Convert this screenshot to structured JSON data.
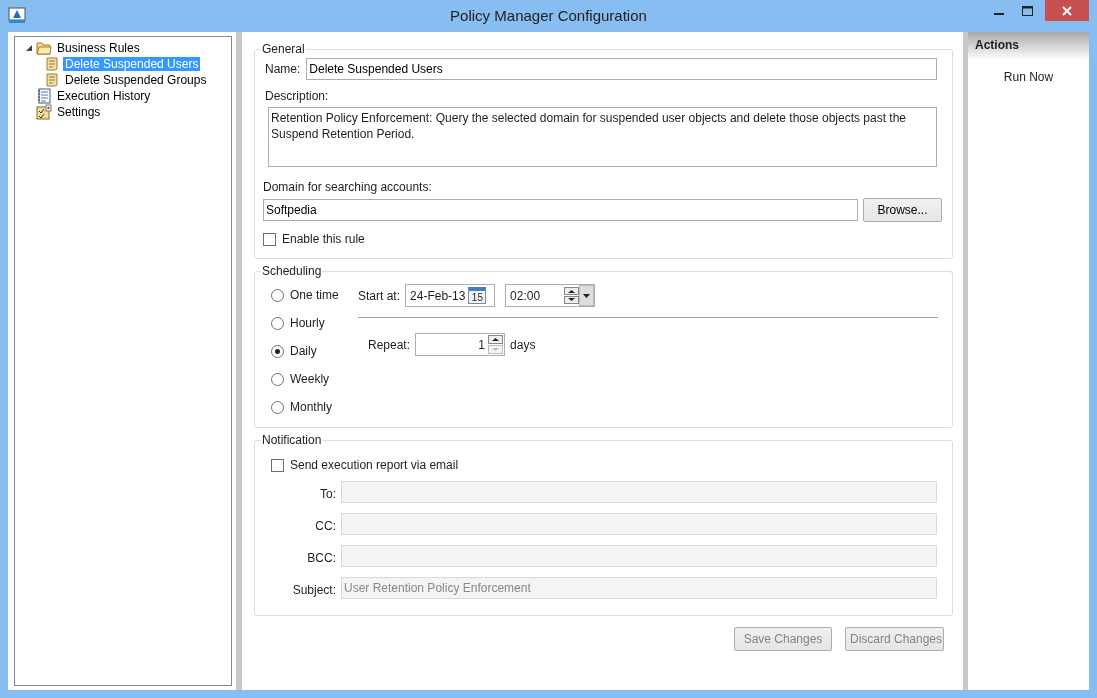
{
  "window": {
    "title": "Policy Manager Configuration"
  },
  "tree": [
    {
      "label": "Business Rules",
      "kind": "folder",
      "expanded": true,
      "selected": false,
      "children": [
        {
          "label": "Delete Suspended Users",
          "kind": "rule",
          "selected": true
        },
        {
          "label": "Delete Suspended Groups",
          "kind": "rule",
          "selected": false
        }
      ]
    },
    {
      "label": "Execution History",
      "kind": "history",
      "selected": false
    },
    {
      "label": "Settings",
      "kind": "settings",
      "selected": false
    }
  ],
  "general": {
    "title": "General",
    "name_label": "Name:",
    "name_value": "Delete Suspended Users",
    "description_label": "Description:",
    "description_value": "Retention Policy Enforcement: Query the selected domain for suspended user objects and delete those objects past the Suspend Retention Period.",
    "domain_label": "Domain for searching accounts:",
    "domain_value": "Softpedia",
    "browse_button": "Browse...",
    "enable": {
      "label": "Enable this rule",
      "checked": false
    }
  },
  "scheduling": {
    "title": "Scheduling",
    "options": [
      {
        "label": "One time",
        "selected": false
      },
      {
        "label": "Hourly",
        "selected": false
      },
      {
        "label": "Daily",
        "selected": true
      },
      {
        "label": "Weekly",
        "selected": false
      },
      {
        "label": "Monthly",
        "selected": false
      }
    ],
    "start_label": "Start at:",
    "date": "24-Feb-13",
    "calendar_day": "15",
    "time": "02:00",
    "repeat_label": "Repeat:",
    "repeat_value": "1",
    "repeat_unit": "days"
  },
  "notification": {
    "title": "Notification",
    "send": {
      "label": "Send execution report via email",
      "checked": false
    },
    "fields": [
      {
        "label": "To:"
      },
      {
        "label": "CC:"
      },
      {
        "label": "BCC:"
      },
      {
        "label": "Subject:",
        "value": "User Retention Policy Enforcement"
      }
    ]
  },
  "buttons": [
    {
      "label": "Save Changes",
      "disabled": true
    },
    {
      "label": "Discard Changes",
      "disabled": true
    }
  ],
  "actions": {
    "title": "Actions",
    "items": [
      "Run Now"
    ]
  }
}
